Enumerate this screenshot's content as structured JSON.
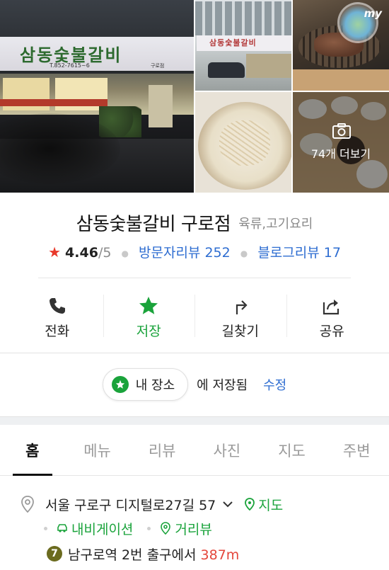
{
  "gallery": {
    "main_sign_text": "삼동숯불갈비",
    "main_sign_tel": "T.852-7615~6",
    "main_sign_branch": "구로점",
    "tr1_sign_text": "삼동숯불갈비",
    "badge_text": "my",
    "more_label": "74개 더보기"
  },
  "place": {
    "name": "삼동숯불갈비 구로점",
    "category": "육류,고기요리",
    "rating": "4.46",
    "rating_max": "/5",
    "visitor_review": "방문자리뷰 252",
    "blog_review": "블로그리뷰 17"
  },
  "actions": [
    {
      "label": "전화",
      "icon": "phone-icon"
    },
    {
      "label": "저장",
      "icon": "star-icon",
      "active": true
    },
    {
      "label": "길찾기",
      "icon": "directions-icon"
    },
    {
      "label": "공유",
      "icon": "share-icon"
    }
  ],
  "saved": {
    "chip_label": "내 장소",
    "saved_text": "에 저장됨",
    "edit_label": "수정"
  },
  "tabs": [
    "홈",
    "메뉴",
    "리뷰",
    "사진",
    "지도",
    "주변"
  ],
  "active_tab": "홈",
  "address": {
    "text": "서울 구로구 디지털로27길 57",
    "map_label": "지도",
    "navigation_label": "내비게이션",
    "street_view_label": "거리뷰",
    "subway_line": "7",
    "subway_station_text": "남구로역 2번 출구에서",
    "distance": "387m"
  },
  "colors": {
    "accent_green": "#1aa33b",
    "link_blue": "#2e6dd1",
    "rating_red": "#e8382a",
    "distance_red": "#e4463b",
    "line7_olive": "#6b6b1f"
  }
}
